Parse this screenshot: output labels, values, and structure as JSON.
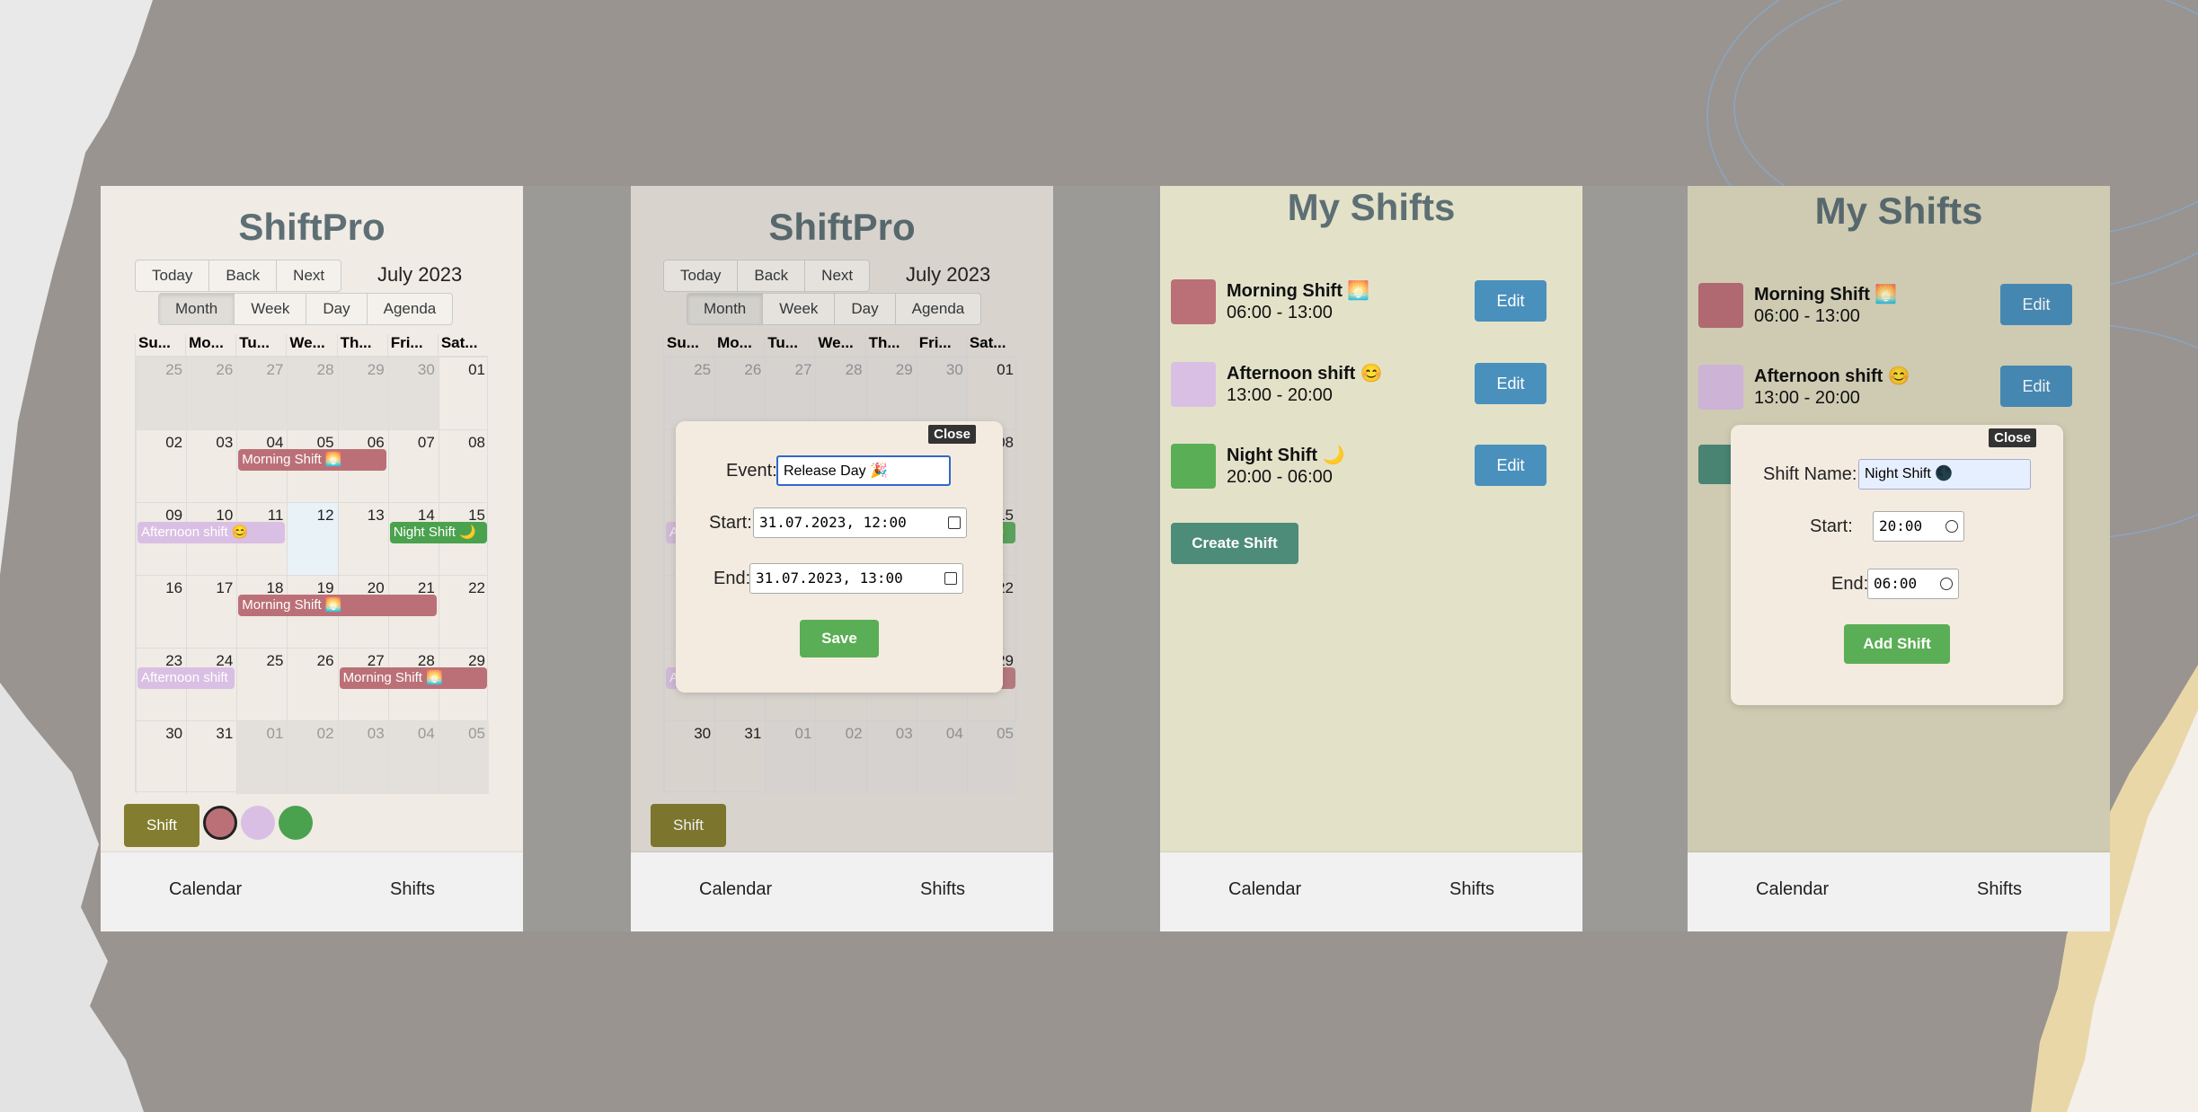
{
  "colors": {
    "morning": "#bb7077",
    "afternoon": "#dabfe4",
    "night": "#4aa24e",
    "title": "#5d6f74",
    "edit": "#4a90bd",
    "save": "#5aae55"
  },
  "panel1": {
    "title": "ShiftPro",
    "nav_buttons": [
      "Today",
      "Back",
      "Next"
    ],
    "month_label": "July 2023",
    "views": [
      "Month",
      "Week",
      "Day",
      "Agenda"
    ],
    "weekdays": [
      "Su...",
      "Mo...",
      "Tu...",
      "We...",
      "Th...",
      "Fri...",
      "Sat..."
    ],
    "weeks": [
      [
        "25",
        "26",
        "27",
        "28",
        "29",
        "30",
        "01"
      ],
      [
        "02",
        "03",
        "04",
        "05",
        "06",
        "07",
        "08"
      ],
      [
        "09",
        "10",
        "11",
        "12",
        "13",
        "14",
        "15"
      ],
      [
        "16",
        "17",
        "18",
        "19",
        "20",
        "21",
        "22"
      ],
      [
        "23",
        "24",
        "25",
        "26",
        "27",
        "28",
        "29"
      ],
      [
        "30",
        "31",
        "01",
        "02",
        "03",
        "04",
        "05"
      ]
    ],
    "events": {
      "w2_morning": "Morning Shift 🌅",
      "w3_afternoon": "Afternoon shift 😊",
      "w3_night": "Night Shift 🌙",
      "w4_morning": "Morning Shift 🌅",
      "w5_afternoon": "Afternoon shift",
      "w5_morning": "Morning Shift 🌅"
    },
    "shift_button": "Shift",
    "bottom_nav": [
      "Calendar",
      "Shifts"
    ]
  },
  "panel2": {
    "title": "ShiftPro",
    "nav_buttons": [
      "Today",
      "Back",
      "Next"
    ],
    "month_label": "July 2023",
    "views": [
      "Month",
      "Week",
      "Day",
      "Agenda"
    ],
    "weekdays": [
      "Su...",
      "Mo...",
      "Tu...",
      "We...",
      "Th...",
      "Fri...",
      "Sat..."
    ],
    "modal": {
      "close": "Close",
      "event_label": "Event:",
      "event_value": "Release Day 🎉",
      "start_label": "Start:",
      "start_value": "31.07.2023, 12:00",
      "end_label": "End:",
      "end_value": "31.07.2023, 13:00",
      "save": "Save"
    },
    "shift_button": "Shift",
    "bottom_nav": [
      "Calendar",
      "Shifts"
    ]
  },
  "panel3": {
    "title": "My Shifts",
    "shifts": [
      {
        "name": "Morning Shift 🌅",
        "time": "06:00 - 13:00",
        "edit": "Edit"
      },
      {
        "name": "Afternoon shift 😊",
        "time": "13:00 - 20:00",
        "edit": "Edit"
      },
      {
        "name": "Night Shift 🌙",
        "time": "20:00 - 06:00",
        "edit": "Edit"
      }
    ],
    "create": "Create Shift",
    "bottom_nav": [
      "Calendar",
      "Shifts"
    ]
  },
  "panel4": {
    "title": "My Shifts",
    "shifts": [
      {
        "name": "Morning Shift 🌅",
        "time": "06:00 - 13:00",
        "edit": "Edit"
      },
      {
        "name": "Afternoon shift 😊",
        "time": "13:00 - 20:00",
        "edit": "Edit"
      }
    ],
    "modal": {
      "close": "Close",
      "name_label": "Shift Name:",
      "name_value": "Night Shift 🌑",
      "start_label": "Start:",
      "start_value": "20:00",
      "end_label": "End:",
      "end_value": "06:00",
      "add": "Add Shift"
    },
    "bottom_nav": [
      "Calendar",
      "Shifts"
    ]
  }
}
